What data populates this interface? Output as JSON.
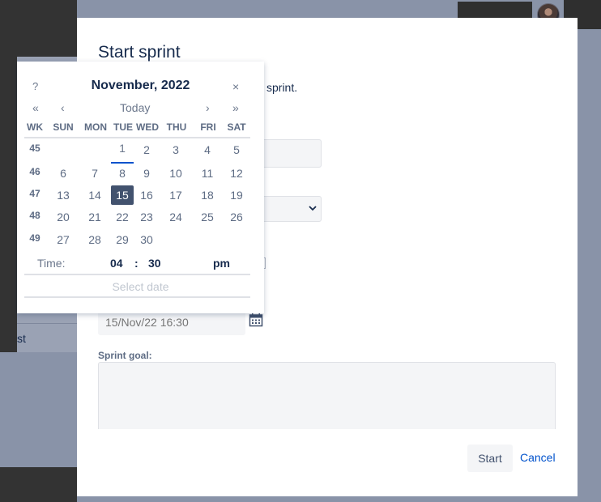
{
  "background": {
    "left_nav_partial_text": "st"
  },
  "dialog": {
    "title": "Start sprint",
    "intro_partial": "sprint.",
    "end_date": {
      "placeholder": "15/Nov/22 16:30"
    },
    "sprint_goal": {
      "label": "Sprint goal:",
      "value": ""
    },
    "start_label": "Start",
    "cancel_label": "Cancel"
  },
  "datepicker": {
    "help_label": "?",
    "title": "November, 2022",
    "close_label": "×",
    "nav": {
      "prev_year": "«",
      "prev_month": "‹",
      "today": "Today",
      "next_month": "›",
      "next_year": "»"
    },
    "headers": [
      "WK",
      "SUN",
      "MON",
      "TUE",
      "WED",
      "THU",
      "FRI",
      "SAT"
    ],
    "weeks": [
      {
        "wk": "45",
        "days": [
          "",
          "",
          "1",
          "2",
          "3",
          "4",
          "5"
        ]
      },
      {
        "wk": "46",
        "days": [
          "6",
          "7",
          "8",
          "9",
          "10",
          "11",
          "12"
        ]
      },
      {
        "wk": "47",
        "days": [
          "13",
          "14",
          "15",
          "16",
          "17",
          "18",
          "19"
        ]
      },
      {
        "wk": "48",
        "days": [
          "20",
          "21",
          "22",
          "23",
          "24",
          "25",
          "26"
        ]
      },
      {
        "wk": "49",
        "days": [
          "27",
          "28",
          "29",
          "30",
          "",
          "",
          ""
        ]
      }
    ],
    "today_day": "1",
    "selected_day": "15",
    "time": {
      "label": "Time:",
      "hours": "04",
      "separator": ":",
      "minutes": "30",
      "ampm": "pm"
    },
    "select_date_label": "Select date"
  },
  "colors": {
    "selected_day_bg": "#42526e",
    "link": "#0052cc",
    "overlay": "#8993a8"
  }
}
